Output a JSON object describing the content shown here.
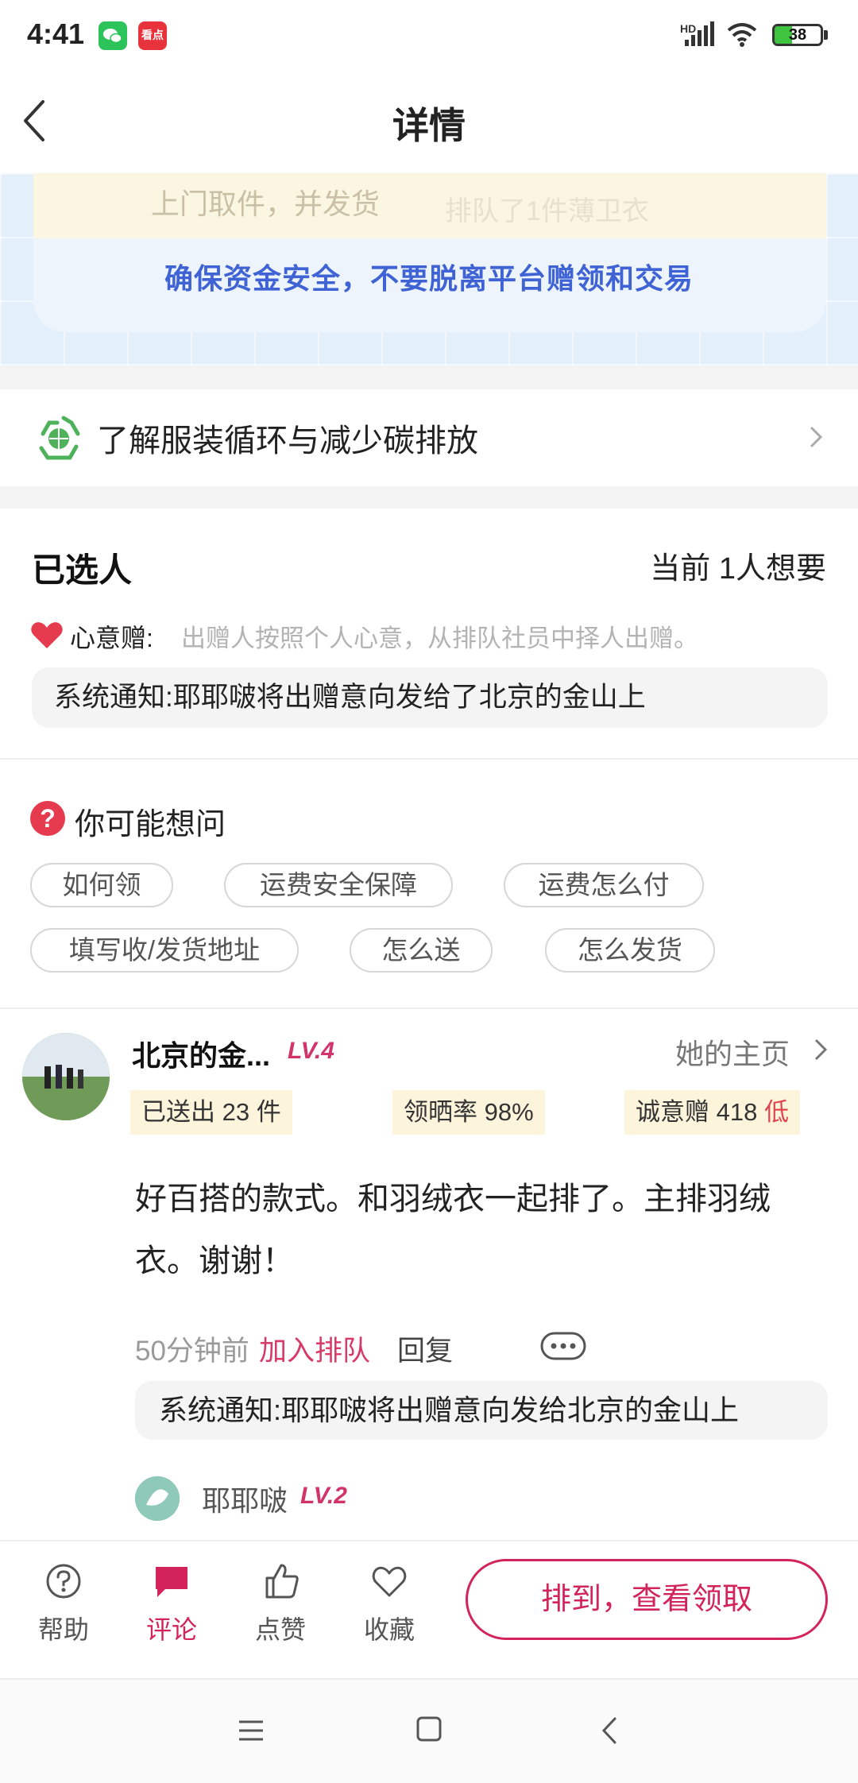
{
  "status_bar": {
    "time": "4:41",
    "app_icon_1": "wechat-icon",
    "app_icon_2": "news-app-icon",
    "app_icon_2_text": "看点",
    "network": "HD",
    "battery": "38",
    "battery_level": 0.38
  },
  "nav": {
    "title": "详情"
  },
  "banner": {
    "ghost_text_1": "上门取件，并发货",
    "ghost_text_2": "排队了1件薄卫衣",
    "safety_text": "确保资金安全，不要脱离平台赠领和交易"
  },
  "recycle": {
    "label": "了解服装循环与减少碳排放"
  },
  "selected": {
    "title": "已选人",
    "count": "当前 1人想要",
    "heart_label": "心意赠:",
    "heart_desc": "出赠人按照个人心意，从排队社员中择人出赠。",
    "notice": "系统通知:耶耶啵将出赠意向发给了北京的金山上"
  },
  "faq": {
    "title": "你可能想问",
    "chips": [
      "如何领",
      "运费安全保障",
      "运费怎么付",
      "填写收/发货地址",
      "怎么送",
      "怎么发货"
    ]
  },
  "comment": {
    "name": "北京的金...",
    "level": "LV.4",
    "home_link": "她的主页",
    "stats": {
      "sent": "已送出 23 件",
      "share_rate": "领晒率 98%",
      "sincerity": "诚意赠 418",
      "sincerity_level": "低"
    },
    "body": "好百搭的款式。和羽绒衣一起排了。主排羽绒衣。谢谢！",
    "time": "50分钟前",
    "join": "加入排队",
    "reply": "回复",
    "notice": "系统通知:耶耶啵将出赠意向发给北京的金山上",
    "reply_user": {
      "name": "耶耶啵",
      "level": "LV.2"
    }
  },
  "bottom_bar": {
    "tabs": [
      {
        "label": "帮助",
        "icon": "help-icon"
      },
      {
        "label": "评论",
        "icon": "comment-icon"
      },
      {
        "label": "点赞",
        "icon": "thumbs-up-icon"
      },
      {
        "label": "收藏",
        "icon": "heart-outline-icon"
      }
    ],
    "active_tab": "评论",
    "cta": "排到，查看领取"
  },
  "colors": {
    "accent": "#d2245a",
    "safety_blue": "#3f63d4",
    "stat_bg": "#fdf4dc",
    "red": "#e63a4f"
  }
}
